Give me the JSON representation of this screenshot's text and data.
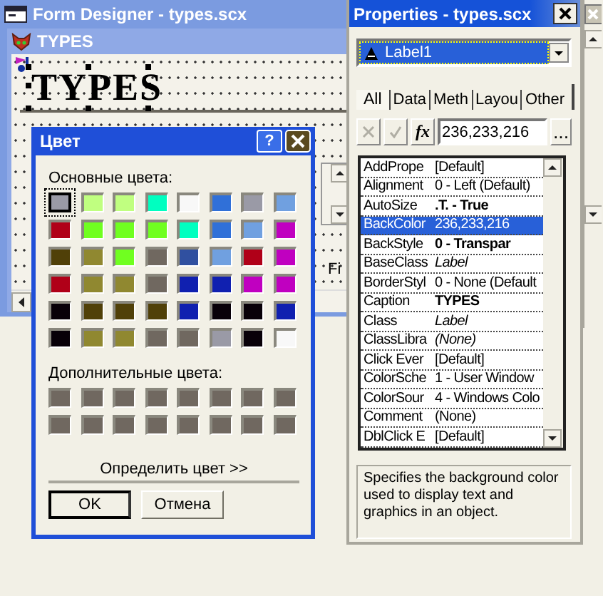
{
  "form_designer": {
    "title": "Form Designer - types.scx",
    "form": {
      "title": "TYPES",
      "label": {
        "caption": "TYPES",
        "selected": true
      },
      "partial_control": "Fi"
    }
  },
  "color_dialog": {
    "title": "Цвет",
    "help_button": "?",
    "basic_label": "Основные цвета:",
    "basic_colors": [
      {
        "color": "#9a9aa6",
        "selected": true
      },
      {
        "color": "#c0ff80",
        "selected": false
      },
      {
        "color": "#c0ff80",
        "selected": false
      },
      {
        "color": "#00ffc0",
        "selected": false
      },
      {
        "color": "#f8f8f8",
        "selected": false
      },
      {
        "color": "#3070d8",
        "selected": false
      },
      {
        "color": "#9a9aa6",
        "selected": false
      },
      {
        "color": "#70a0e0",
        "selected": false
      },
      {
        "color": "#b00018",
        "selected": false
      },
      {
        "color": "#70ff20",
        "selected": false
      },
      {
        "color": "#70ff20",
        "selected": false
      },
      {
        "color": "#70ff20",
        "selected": false
      },
      {
        "color": "#00ffc0",
        "selected": false
      },
      {
        "color": "#3070d8",
        "selected": false
      },
      {
        "color": "#70a0e0",
        "selected": false
      },
      {
        "color": "#c000c0",
        "selected": false
      },
      {
        "color": "#504008",
        "selected": false
      },
      {
        "color": "#908830",
        "selected": false
      },
      {
        "color": "#70ff20",
        "selected": false
      },
      {
        "color": "#706860",
        "selected": false
      },
      {
        "color": "#3050a0",
        "selected": false
      },
      {
        "color": "#70a0e0",
        "selected": false
      },
      {
        "color": "#b00018",
        "selected": false
      },
      {
        "color": "#c000c0",
        "selected": false
      },
      {
        "color": "#b00018",
        "selected": false
      },
      {
        "color": "#908830",
        "selected": false
      },
      {
        "color": "#908830",
        "selected": false
      },
      {
        "color": "#706860",
        "selected": false
      },
      {
        "color": "#1020b0",
        "selected": false
      },
      {
        "color": "#1020b0",
        "selected": false
      },
      {
        "color": "#c000c0",
        "selected": false
      },
      {
        "color": "#c000c0",
        "selected": false
      },
      {
        "color": "#080008",
        "selected": false
      },
      {
        "color": "#504008",
        "selected": false
      },
      {
        "color": "#504008",
        "selected": false
      },
      {
        "color": "#504008",
        "selected": false
      },
      {
        "color": "#1020b0",
        "selected": false
      },
      {
        "color": "#080008",
        "selected": false
      },
      {
        "color": "#080008",
        "selected": false
      },
      {
        "color": "#1020b0",
        "selected": false
      },
      {
        "color": "#080008",
        "selected": false
      },
      {
        "color": "#908830",
        "selected": false
      },
      {
        "color": "#908830",
        "selected": false
      },
      {
        "color": "#706860",
        "selected": false
      },
      {
        "color": "#706860",
        "selected": false
      },
      {
        "color": "#9a9aa6",
        "selected": false
      },
      {
        "color": "#080008",
        "selected": false
      },
      {
        "color": "#f8f8f8",
        "selected": false
      }
    ],
    "custom_label": "Дополнительные цвета:",
    "custom_colors": [
      {
        "color": "#706860"
      },
      {
        "color": "#706860"
      },
      {
        "color": "#706860"
      },
      {
        "color": "#706860"
      },
      {
        "color": "#706860"
      },
      {
        "color": "#706860"
      },
      {
        "color": "#706860"
      },
      {
        "color": "#706860"
      },
      {
        "color": "#706860"
      },
      {
        "color": "#706860"
      },
      {
        "color": "#706860"
      },
      {
        "color": "#706860"
      },
      {
        "color": "#706860"
      },
      {
        "color": "#706860"
      },
      {
        "color": "#706860"
      },
      {
        "color": "#706860"
      }
    ],
    "define_button": "Определить цвет >>",
    "buttons": [
      {
        "label": "OK",
        "default": true
      },
      {
        "label": "Отмена",
        "default": false
      }
    ]
  },
  "properties": {
    "title": "Properties - types.scx",
    "object": "Label1",
    "tabs": [
      {
        "label": "All",
        "selected": true
      },
      {
        "label": "Data",
        "selected": false
      },
      {
        "label": "Meth",
        "selected": false
      },
      {
        "label": "Layou",
        "selected": false
      },
      {
        "label": "Other",
        "selected": false
      }
    ],
    "toolbar": {
      "cancel_disabled": true,
      "accept_disabled": true,
      "function_button": "fx",
      "value": "236,233,216",
      "more_button": "..."
    },
    "rows": [
      {
        "name": "AddPrope",
        "value": "[Default]",
        "kind": "default",
        "selected": false
      },
      {
        "name": "Alignment",
        "value": "0 - Left (Default)",
        "kind": "default",
        "selected": false
      },
      {
        "name": "AutoSize",
        "value": ".T. - True",
        "kind": "changed",
        "selected": false
      },
      {
        "name": "BackColor",
        "value": "236,233,216",
        "kind": "default",
        "selected": true
      },
      {
        "name": "BackStyle",
        "value": "0 - Transpar",
        "kind": "changed",
        "selected": false
      },
      {
        "name": "BaseClass",
        "value": "Label",
        "kind": "readonly",
        "selected": false
      },
      {
        "name": "BorderStyl",
        "value": "0 - None (Default",
        "kind": "default",
        "selected": false
      },
      {
        "name": "Caption",
        "value": "TYPES",
        "kind": "changed",
        "selected": false
      },
      {
        "name": "Class",
        "value": "Label",
        "kind": "readonly",
        "selected": false
      },
      {
        "name": "ClassLibra",
        "value": "(None)",
        "kind": "readonly",
        "selected": false
      },
      {
        "name": "Click Ever",
        "value": "[Default]",
        "kind": "default",
        "selected": false
      },
      {
        "name": "ColorSche",
        "value": "1 - User Window",
        "kind": "default",
        "selected": false
      },
      {
        "name": "ColorSour",
        "value": "4 - Windows Colo",
        "kind": "default",
        "selected": false
      },
      {
        "name": "Comment",
        "value": "(None)",
        "kind": "default",
        "selected": false
      },
      {
        "name": "DblClick E",
        "value": "[Default]",
        "kind": "default",
        "selected": false
      }
    ],
    "description": "Specifies the background color used to display text and graphics in an object."
  }
}
